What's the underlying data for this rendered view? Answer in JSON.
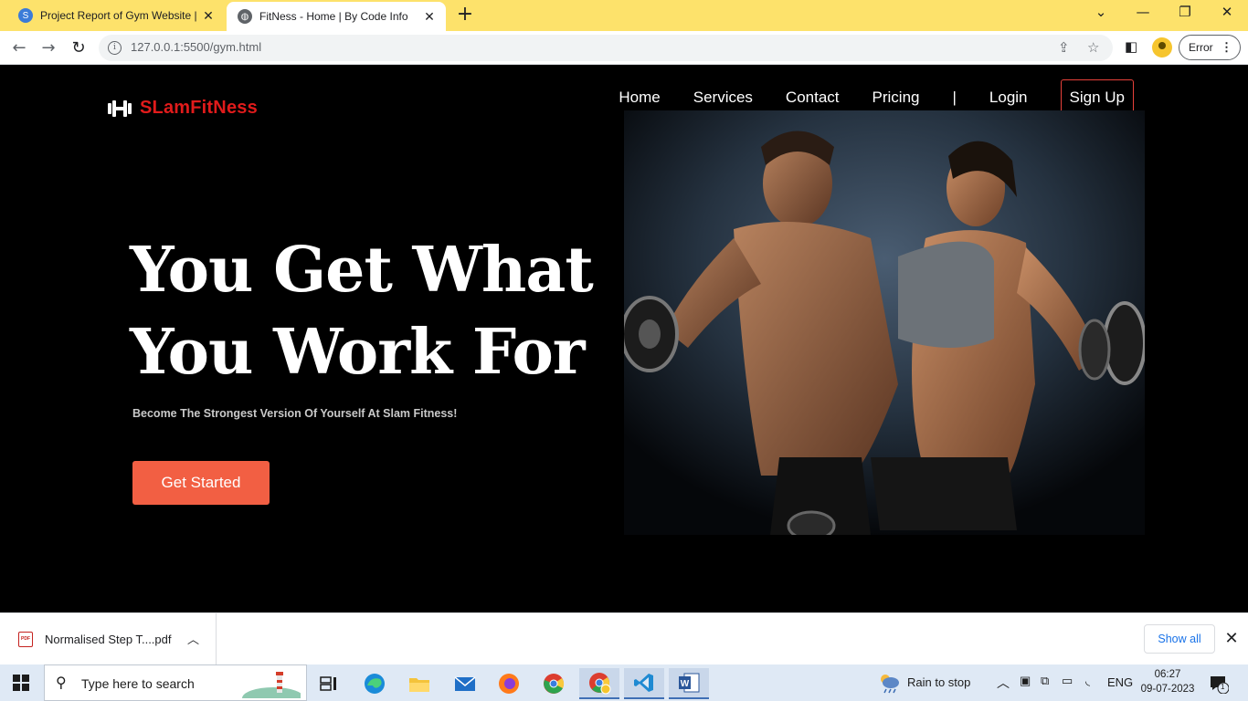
{
  "browser": {
    "tabs": [
      {
        "title": "Project Report of Gym Website | ",
        "close": "✕"
      },
      {
        "title": "FitNess - Home | By Code Info",
        "close": "✕"
      }
    ],
    "new_tab": "+",
    "url": "127.0.0.1:5500/gym.html",
    "error_label": "Error",
    "accent_color": "#fde26b"
  },
  "site": {
    "logo_text": "SLamFitNess",
    "brand_color": "#e01b1b",
    "nav": {
      "home": "Home",
      "services": "Services",
      "contact": "Contact",
      "pricing": "Pricing",
      "separator": "|",
      "login": "Login",
      "signup": "Sign Up"
    },
    "hero": {
      "title_line1": "You Get What",
      "title_line2": "You Work For",
      "subtitle": "Become The Strongest Version Of Yourself At Slam Fitness!",
      "cta": "Get Started",
      "cta_color": "#f25f43"
    }
  },
  "downloads": {
    "file_name": "Normalised Step T....pdf",
    "file_type": "PDF",
    "show_all": "Show all"
  },
  "taskbar": {
    "search_placeholder": "Type here to search",
    "weather": "Rain to stop",
    "language": "ENG",
    "time": "06:27",
    "date": "09-07-2023",
    "notification_count": "1"
  }
}
